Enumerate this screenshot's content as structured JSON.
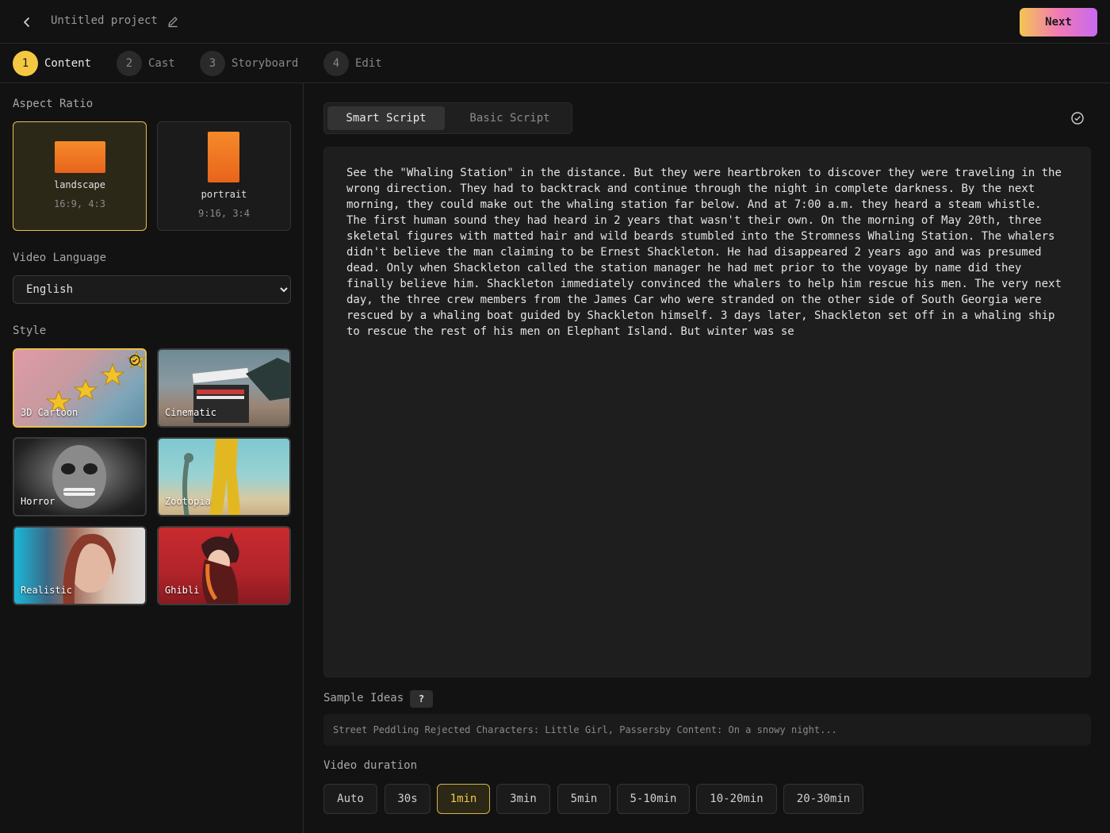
{
  "header": {
    "project_title": "Untitled project",
    "next_label": "Next"
  },
  "steps": [
    {
      "num": "1",
      "label": "Content"
    },
    {
      "num": "2",
      "label": "Cast"
    },
    {
      "num": "3",
      "label": "Storyboard"
    },
    {
      "num": "4",
      "label": "Edit"
    }
  ],
  "sidebar": {
    "aspect_ratio_label": "Aspect Ratio",
    "ratios": [
      {
        "name": "landscape",
        "sub": "16:9, 4:3"
      },
      {
        "name": "portrait",
        "sub": "9:16, 3:4"
      }
    ],
    "video_language_label": "Video Language",
    "language_selected": "English",
    "style_label": "Style",
    "styles": [
      {
        "name": "3D Cartoon"
      },
      {
        "name": "Cinematic"
      },
      {
        "name": "Horror"
      },
      {
        "name": "Zootopia"
      },
      {
        "name": "Realistic"
      },
      {
        "name": "Ghibli"
      }
    ]
  },
  "main": {
    "tabs": [
      {
        "label": "Smart Script"
      },
      {
        "label": "Basic Script"
      }
    ],
    "script_text": "See the \"Whaling Station\" in the distance. But they were heartbroken to discover they were traveling in the wrong direction. They had to backtrack and continue through the night in complete darkness. By the next morning, they could make out the whaling station far below. And at 7:00 a.m. they heard a steam whistle. The first human sound they had heard in 2 years that wasn't their own. On the morning of May 20th, three skeletal figures with matted hair and wild beards stumbled into the Stromness Whaling Station. The whalers didn't believe the man claiming to be Ernest Shackleton. He had disappeared 2 years ago and was presumed dead. Only when Shackleton called the station manager he had met prior to the voyage by name did they finally believe him. Shackleton immediately convinced the whalers to help him rescue his men. The very next day, the three crew members from the James Car who were stranded on the other side of South Georgia were rescued by a whaling boat guided by Shackleton himself. 3 days later, Shackleton set off in a whaling ship to rescue the rest of his men on Elephant Island. But winter was se",
    "sample_ideas_label": "Sample Ideas",
    "help_label": "?",
    "sample_idea_text": "Street Peddling Rejected Characters: Little Girl, Passersby Content: On a snowy night...",
    "video_duration_label": "Video duration",
    "durations": [
      "Auto",
      "30s",
      "1min",
      "3min",
      "5min",
      "5-10min",
      "10-20min",
      "20-30min"
    ],
    "selected_duration": "1min"
  },
  "colors": {
    "accent": "#f5c842",
    "selected_border": "#e8c04a",
    "orange_shape": "#f27a24"
  }
}
